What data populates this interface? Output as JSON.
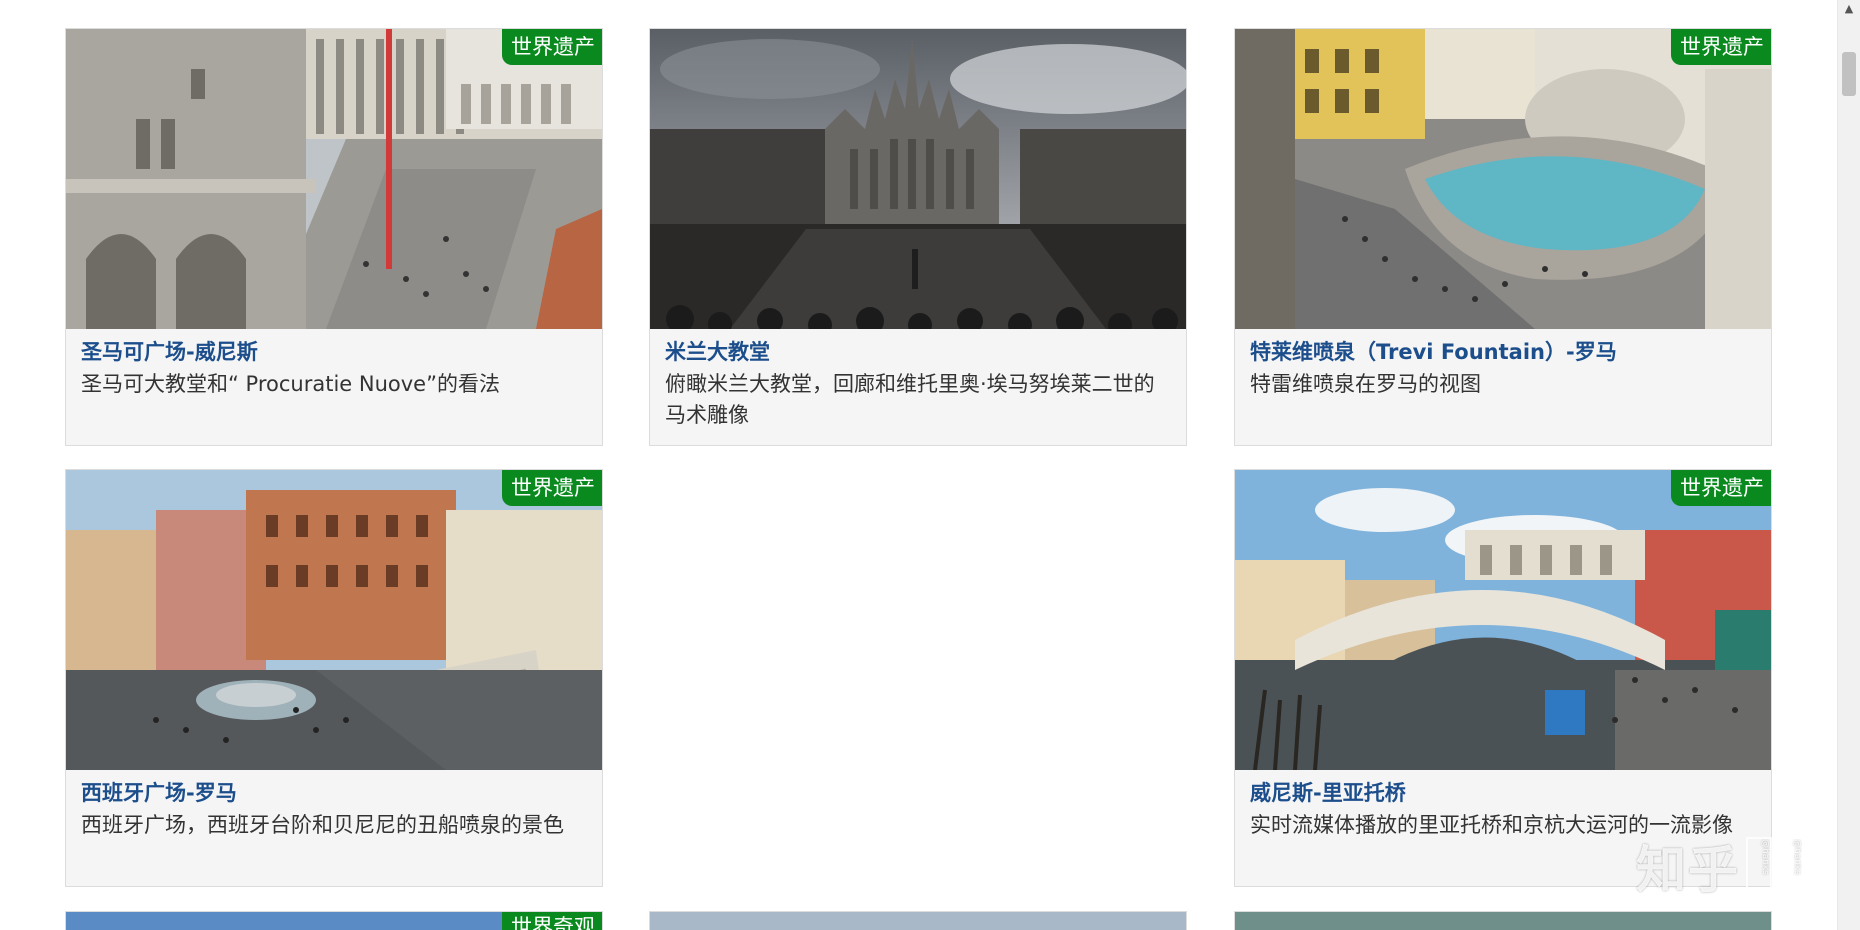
{
  "cards": [
    {
      "title": "圣马可广场-威尼斯",
      "description": "圣马可大教堂和“ Procuratie Nuove”的看法",
      "badge": "世界遗产",
      "image": "st-marks-square-venice-image"
    },
    {
      "title": "米兰大教堂",
      "description": "俯瞰米兰大教堂，回廊和维托里奥·埃马努埃莱二世的马术雕像",
      "badge": "",
      "image": "milan-cathedral-image"
    },
    {
      "title": "特莱维喷泉（Trevi Fountain）-罗马",
      "description": "特雷维喷泉在罗马的视图",
      "badge": "世界遗产",
      "image": "trevi-fountain-image"
    },
    {
      "title": "西班牙广场-罗马",
      "description": "西班牙广场，西班牙台阶和贝尼尼的丑船喷泉的景色",
      "badge": "世界遗产",
      "image": "spanish-steps-image"
    },
    {
      "title": "威尼斯-里亚托桥",
      "description": "实时流媒体播放的里亚托桥和京杭大运河的一流影像",
      "badge": "世界遗产",
      "image": "rialto-bridge-image"
    }
  ],
  "partial_badge": "世界奇观",
  "watermark": {
    "logo": "知乎",
    "box_text": "@hanks"
  },
  "colors": {
    "badge_green": "#0a8a1e",
    "title_blue": "#1c4e8c",
    "card_bg": "#f5f5f5"
  }
}
